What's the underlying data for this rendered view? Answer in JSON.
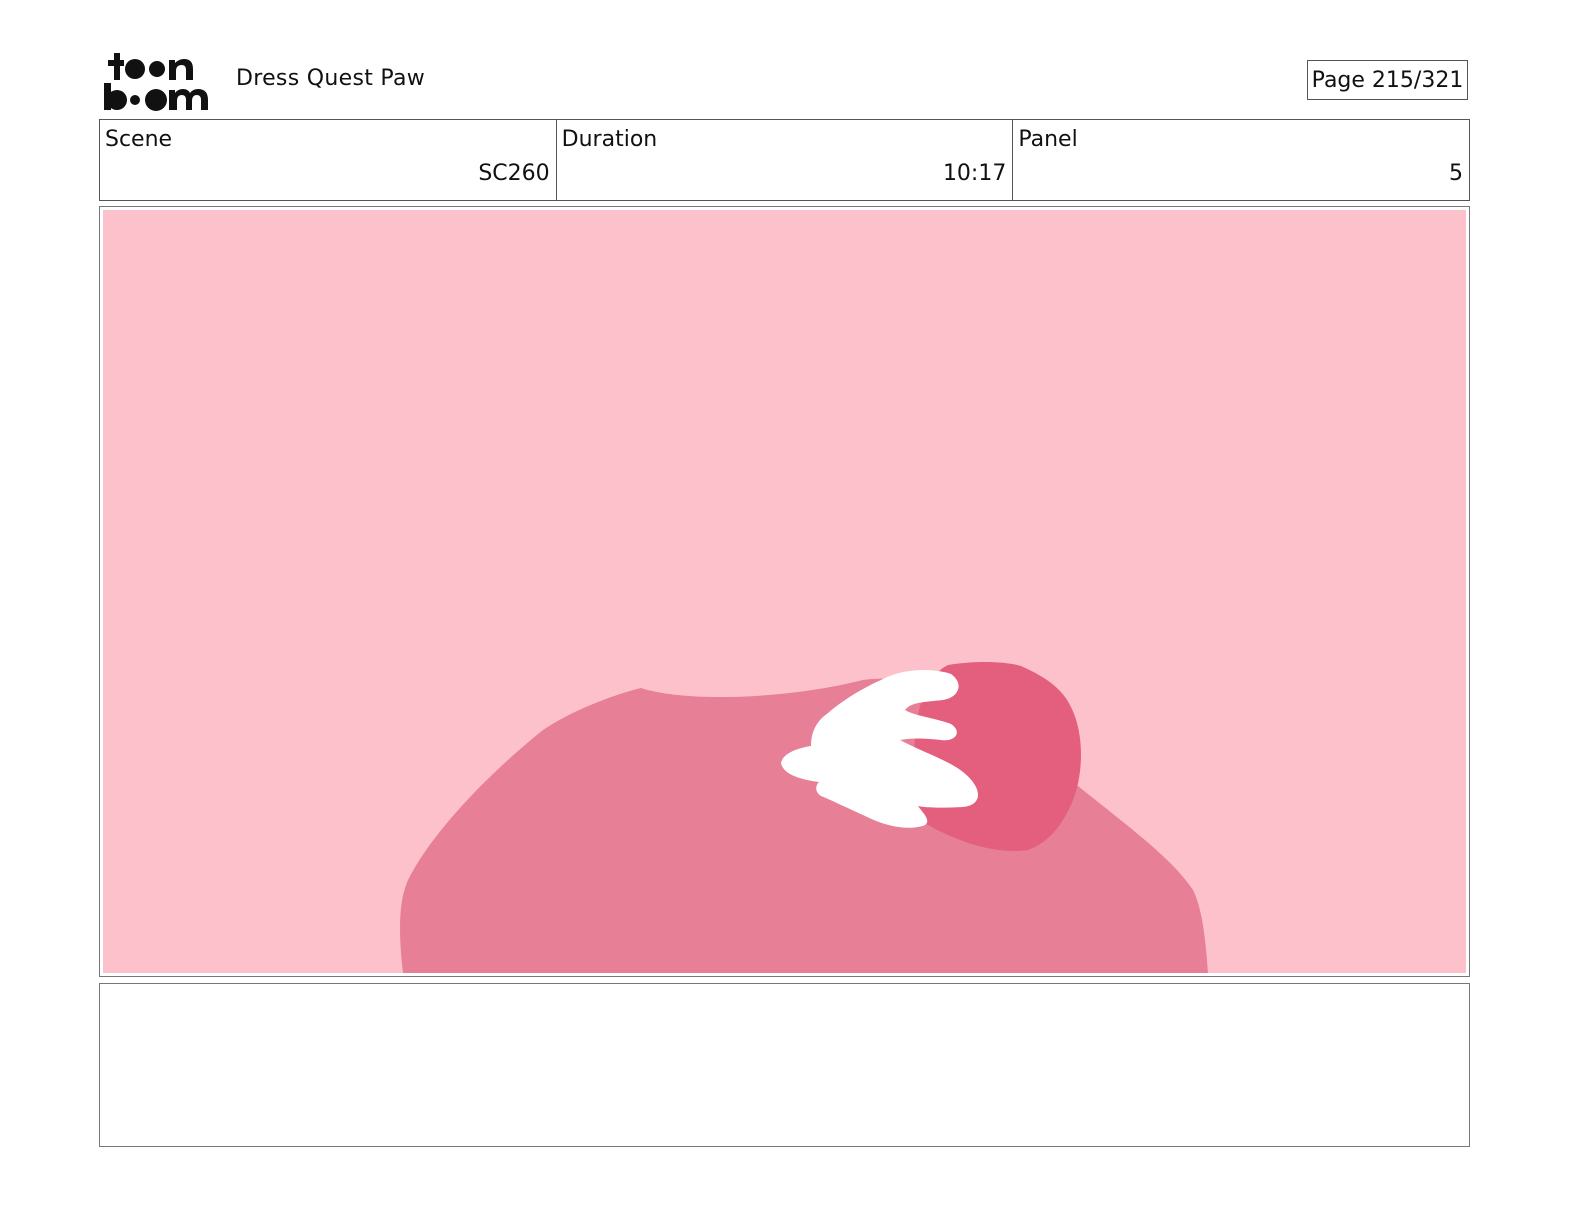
{
  "header": {
    "logo_text": "toonboom",
    "project_title": "Dress Quest Paw",
    "page_label": "Page 215/321"
  },
  "info": {
    "scene_label": "Scene",
    "scene_value": "SC260",
    "duration_label": "Duration",
    "duration_value": "10:17",
    "panel_label": "Panel",
    "panel_value": "5"
  },
  "panel": {
    "background_color": "#fdc1cc",
    "body_color": "#e77f96",
    "ball_color": "#e45f7e",
    "paw_color": "#ffffff"
  },
  "notes": {
    "text": ""
  }
}
